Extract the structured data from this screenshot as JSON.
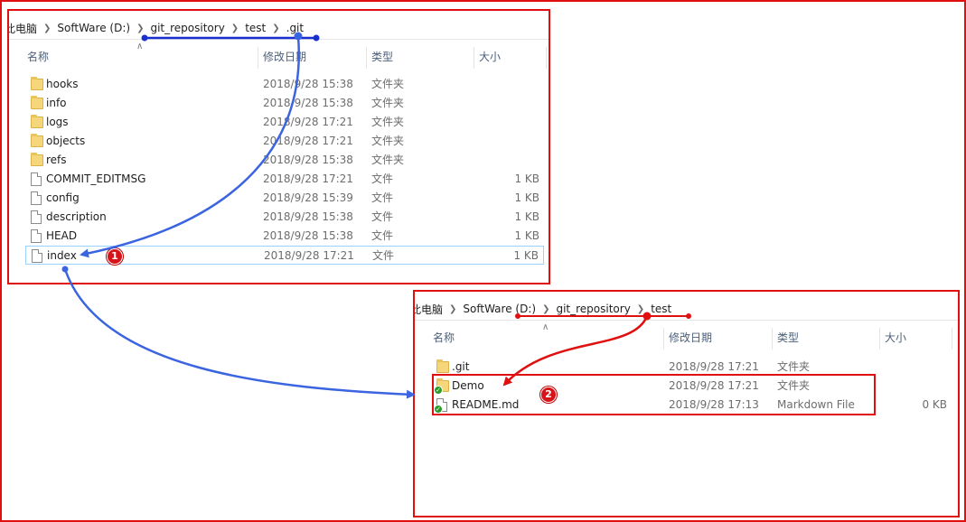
{
  "top_explorer": {
    "breadcrumb": [
      "此电脑",
      "SoftWare (D:)",
      "git_repository",
      "test",
      ".git"
    ],
    "columns": {
      "name": "名称",
      "date": "修改日期",
      "type": "类型",
      "size": "大小"
    },
    "rows": [
      {
        "name": "hooks",
        "date": "2018/9/28 15:38",
        "type": "文件夹",
        "size": "",
        "icon": "folder-icon"
      },
      {
        "name": "info",
        "date": "2018/9/28 15:38",
        "type": "文件夹",
        "size": "",
        "icon": "folder-icon"
      },
      {
        "name": "logs",
        "date": "2018/9/28 17:21",
        "type": "文件夹",
        "size": "",
        "icon": "folder-icon"
      },
      {
        "name": "objects",
        "date": "2018/9/28 17:21",
        "type": "文件夹",
        "size": "",
        "icon": "folder-icon"
      },
      {
        "name": "refs",
        "date": "2018/9/28 15:38",
        "type": "文件夹",
        "size": "",
        "icon": "folder-icon"
      },
      {
        "name": "COMMIT_EDITMSG",
        "date": "2018/9/28 17:21",
        "type": "文件",
        "size": "1 KB",
        "icon": "file-icon"
      },
      {
        "name": "config",
        "date": "2018/9/28 15:39",
        "type": "文件",
        "size": "1 KB",
        "icon": "file-icon"
      },
      {
        "name": "description",
        "date": "2018/9/28 15:38",
        "type": "文件",
        "size": "1 KB",
        "icon": "file-icon"
      },
      {
        "name": "HEAD",
        "date": "2018/9/28 15:38",
        "type": "文件",
        "size": "1 KB",
        "icon": "file-icon"
      },
      {
        "name": "index",
        "date": "2018/9/28 17:21",
        "type": "文件",
        "size": "1 KB",
        "icon": "file-icon"
      }
    ]
  },
  "bottom_explorer": {
    "breadcrumb": [
      "此电脑",
      "SoftWare (D:)",
      "git_repository",
      "test"
    ],
    "columns": {
      "name": "名称",
      "date": "修改日期",
      "type": "类型",
      "size": "大小"
    },
    "rows": [
      {
        "name": ".git",
        "date": "2018/9/28 17:21",
        "type": "文件夹",
        "size": "",
        "icon": "folder-icon"
      },
      {
        "name": "Demo",
        "date": "2018/9/28 17:21",
        "type": "文件夹",
        "size": "",
        "icon": "folder-icon"
      },
      {
        "name": "README.md",
        "date": "2018/9/28 17:13",
        "type": "Markdown File",
        "size": "0 KB",
        "icon": "file-icon"
      }
    ]
  },
  "callouts": {
    "one": "1",
    "two": "2"
  },
  "colors": {
    "frame_red": "#e01010",
    "arrow_blue": "#3a64e0",
    "arrow_red": "#e01010",
    "underline_blue": "#1a2fd0"
  }
}
